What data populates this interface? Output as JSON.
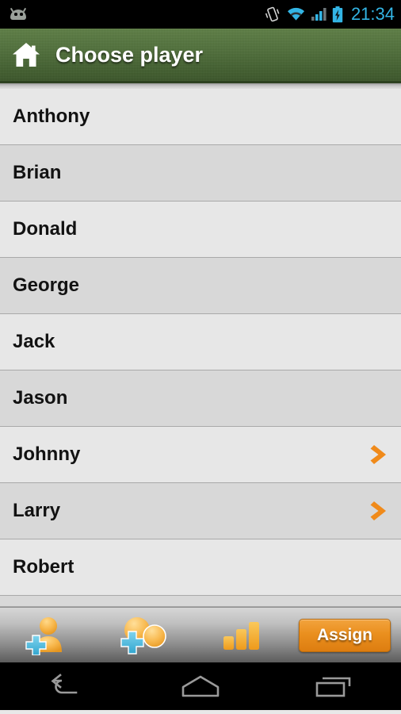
{
  "statusbar": {
    "notification_icon": "android-robot-icon",
    "icons": [
      "vibrate-icon",
      "wifi-icon",
      "signal-icon",
      "battery-charging-icon"
    ],
    "time": "21:34",
    "clock_color": "#33b5e5"
  },
  "actionbar": {
    "home_icon": "home-icon",
    "title": "Choose player",
    "background_color": "#52723c"
  },
  "list": {
    "rows": [
      {
        "name": "Anthony",
        "has_arrow": false
      },
      {
        "name": "Brian",
        "has_arrow": false
      },
      {
        "name": "Donald",
        "has_arrow": false
      },
      {
        "name": "George",
        "has_arrow": false
      },
      {
        "name": "Jack",
        "has_arrow": false
      },
      {
        "name": "Jason",
        "has_arrow": false
      },
      {
        "name": "Johnny",
        "has_arrow": true
      },
      {
        "name": "Larry",
        "has_arrow": true
      },
      {
        "name": "Robert",
        "has_arrow": false
      }
    ],
    "arrow_icon": "chevron-right-icon",
    "arrow_color": "#f08a1a",
    "row_bg_odd": "#e7e7e7",
    "row_bg_even": "#d8d8d8"
  },
  "toolbar": {
    "add_player_icon": "add-person-icon",
    "add_group_icon": "add-group-icon",
    "stats_icon": "bar-chart-icon",
    "assign_label": "Assign",
    "assign_color": "#ea8f1e"
  },
  "navbar": {
    "back_icon": "back-icon",
    "home_icon": "home-icon",
    "recents_icon": "recents-icon"
  }
}
